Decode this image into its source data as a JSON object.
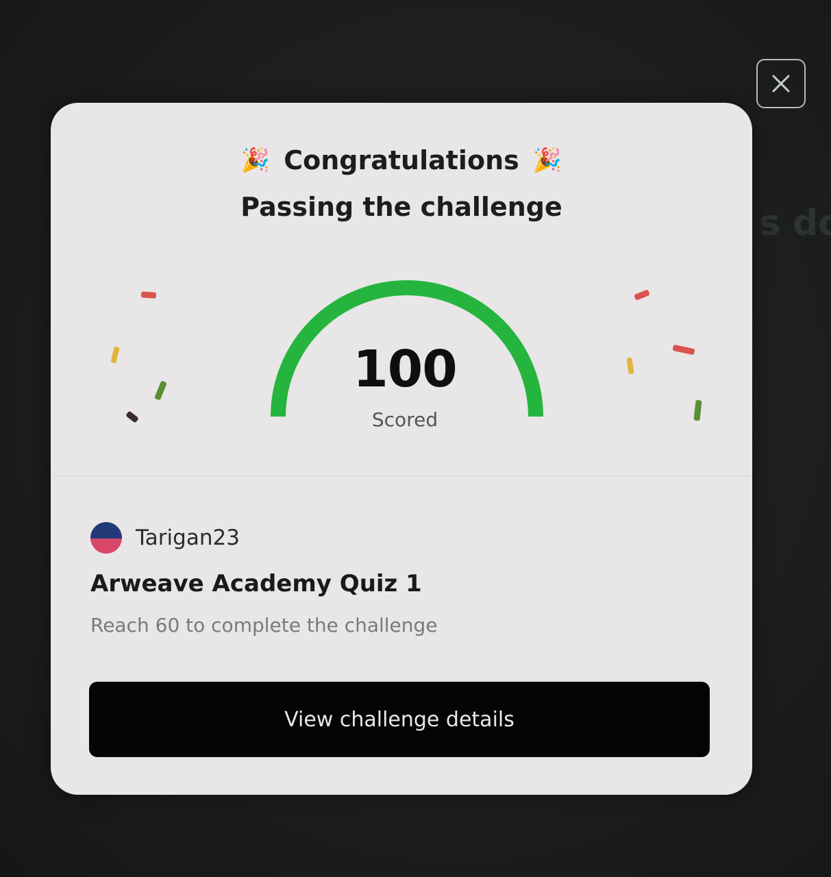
{
  "background": {
    "partial_text": "s do"
  },
  "modal": {
    "close_icon": "close-icon",
    "headline": "Congratulations",
    "headline_icon": "party-popper-icon",
    "headline_icon_glyph": "🎉",
    "subtitle": "Passing the challenge",
    "score": {
      "value": "100",
      "label": "Scored",
      "fraction_filled": 1.0,
      "gauge_color": "#25b53e"
    },
    "user": {
      "avatar_icon": "avatar",
      "name": "Tarigan23"
    },
    "challenge": {
      "title": "Arweave Academy Quiz 1",
      "description": "Reach 60 to complete the challenge"
    },
    "button_label": "View challenge details"
  },
  "colors": {
    "card_bg": "#e8e6e6",
    "button_bg": "#050505",
    "confetti": [
      "#d9534f",
      "#e3b43b",
      "#5a8f35",
      "#3a2a2a"
    ]
  }
}
